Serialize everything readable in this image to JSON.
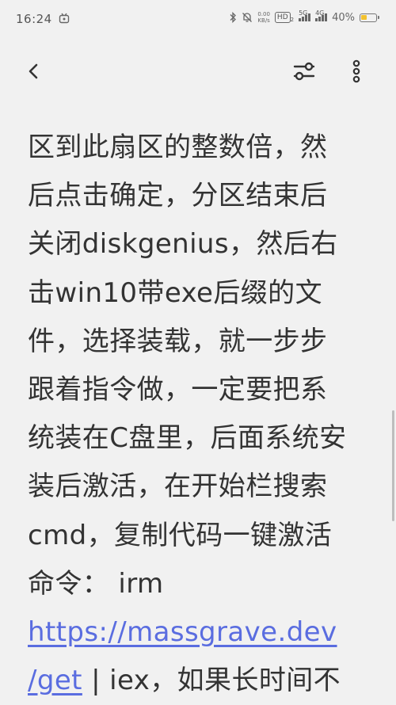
{
  "status_bar": {
    "time": "16:24",
    "net_speed_value": "0.00",
    "net_speed_unit": "KB/s",
    "hd_label": "HD",
    "hd_sub": "2",
    "sig1_label": "5G",
    "sig2_label": "4G",
    "battery_pct": "40%",
    "battery_level": 0.4,
    "battery_color": "#f2c12e"
  },
  "toolbar": {
    "back_icon": "chevron-left-icon",
    "filter_icon": "sliders-icon",
    "more_icon": "more-vertical-icon"
  },
  "article": {
    "lines": [
      "区到此扇区的整数倍，然",
      "后点击确定，分区结束后",
      "关闭diskgenius，然后右",
      "击win10带exe后缀的文",
      "件，选择装载，就一步步",
      "跟着指令做，一定要把系",
      "统装在C盘里，后面系统安",
      "装后激活，在开始栏搜索",
      "cmd，复制代码一键激活",
      "命令： irm"
    ],
    "link_part1": "https://massgrave.dev",
    "link_part2": "/get",
    "after_link": " | iex，如果长时间不",
    "link_color": "#5a6de0"
  }
}
